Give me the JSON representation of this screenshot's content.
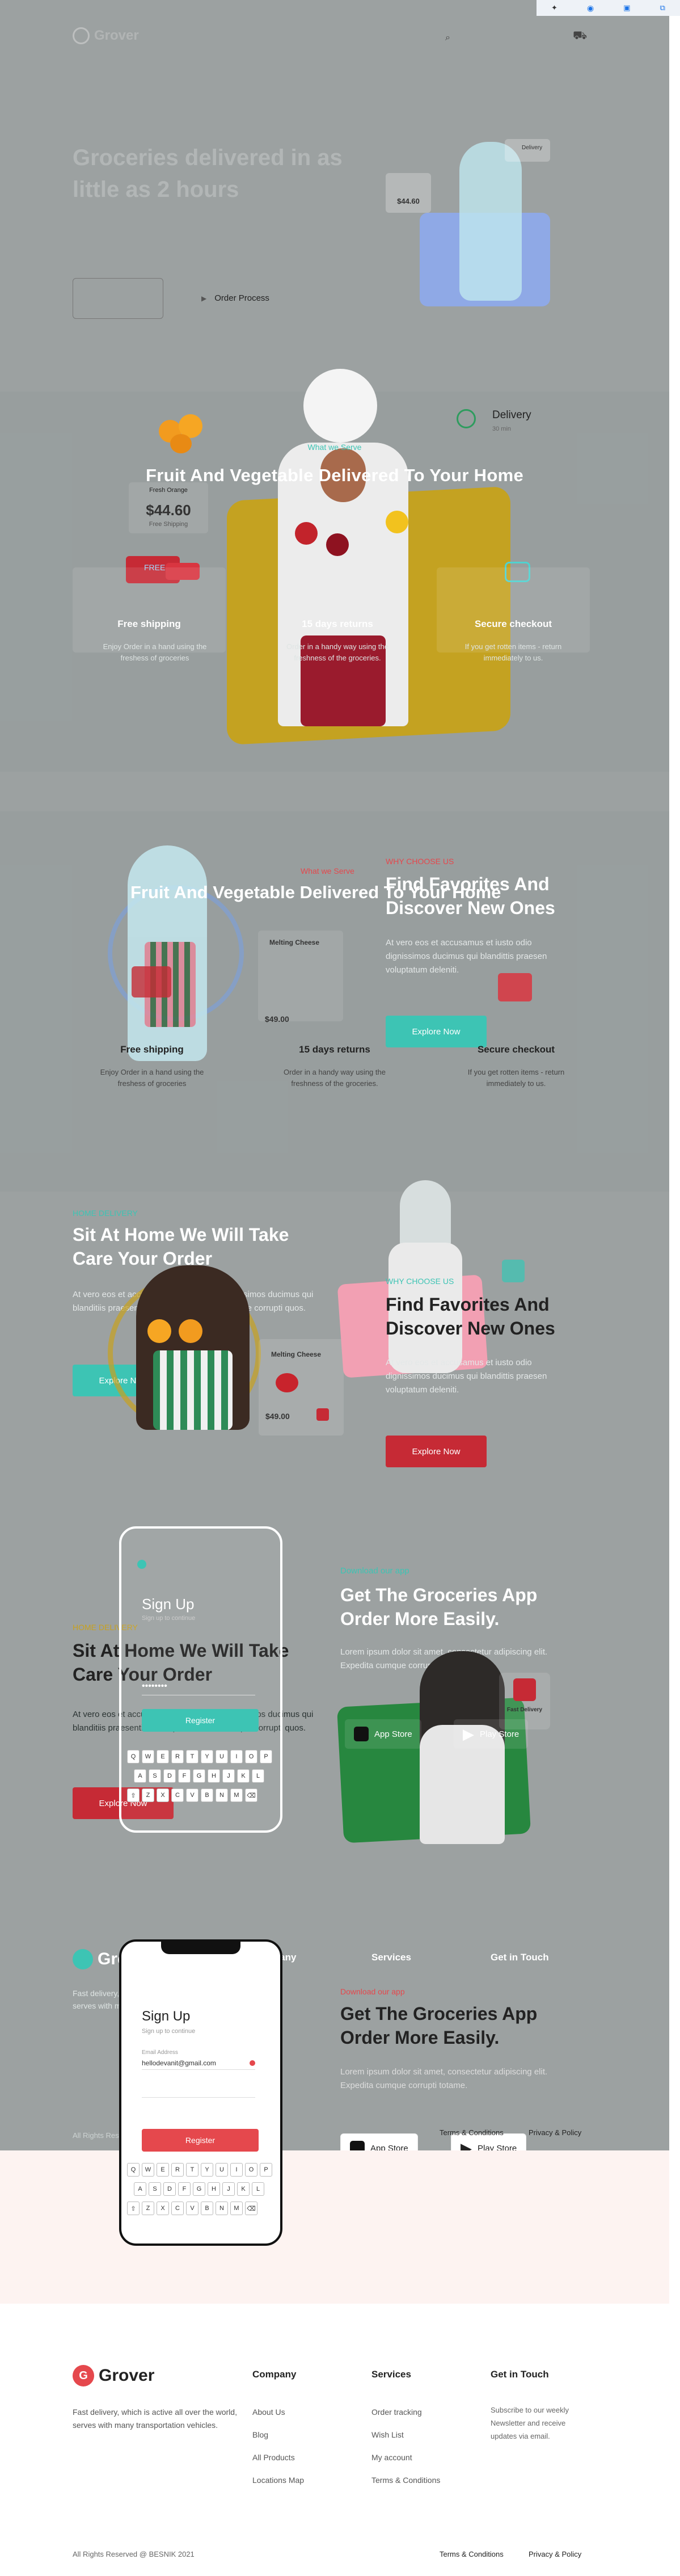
{
  "header": {
    "brand": "Grover"
  },
  "hero": {
    "title": "Groceries delivered in as little as 2 hours",
    "order_process": "Order Process",
    "price": "$44.60",
    "delivery": "Delivery"
  },
  "services": {
    "subtitle": "What we Serve",
    "heading": "Fruit And Vegetable Delivered To Your Home",
    "price_card": {
      "label": "Fresh Orange",
      "price": "$44.60",
      "note": "Free Shipping"
    },
    "free_badge": "FREE",
    "delivery_card": {
      "title": "Delivery",
      "time": "30 min"
    },
    "features": [
      {
        "title": "Free shipping",
        "desc": "Enjoy Order in a hand using the freshess of groceries"
      },
      {
        "title": "15 days returns",
        "desc": "Order in a handy way using the freshness of the groceries."
      },
      {
        "title": "Secure checkout",
        "desc": "If you get rotten items - return immediately to us."
      }
    ]
  },
  "why": {
    "ghost_subtitle": "What we Serve",
    "ghost_heading": "Fruit And Vegetable Delivered To Your Home",
    "label": "WHY CHOOSE US",
    "heading": "Find Favorites And Discover New Ones",
    "paragraph": "At vero eos et accusamus et iusto odio dignissimos ducimus qui blandittis praesen voluptatum deleniti.",
    "button": "Explore Now",
    "product_card": {
      "name": "Melting Cheese",
      "price": "$49.00"
    }
  },
  "home": {
    "label": "HOME DELIVERY",
    "heading": "Sit At Home We Will Take Care Your Order",
    "paragraph": "At vero eos et accusamus et iusto odio dignissimos ducimus qui blanditiis praesentium voluptatum deleniti atque corrupti quos.",
    "button": "Explore Now",
    "product_card": {
      "name": "Melting Cheese",
      "price": "$49.00"
    }
  },
  "download": {
    "label": "Download our app",
    "heading": "Get The Groceries App Order More Easily.",
    "paragraph": "Lorem ipsum dolor sit amet, consectetur adipiscing elit. Expedita cumque corrupti totame.",
    "app_store": "App Store",
    "play_store": "Play Store",
    "card_title": "Fast Delivery"
  },
  "signup": {
    "title": "Sign Up",
    "subtitle": "Sign up to continue",
    "email_label": "Email Address",
    "email": "hellodevanit@gmail.com",
    "password": "••••••••",
    "button": "Register"
  },
  "keyboard": {
    "rows": [
      [
        "Q",
        "W",
        "E",
        "R",
        "T",
        "Y",
        "U",
        "I",
        "O",
        "P"
      ],
      [
        "A",
        "S",
        "D",
        "F",
        "G",
        "H",
        "J",
        "K",
        "L"
      ],
      [
        "⇧",
        "Z",
        "X",
        "C",
        "V",
        "B",
        "N",
        "M",
        "⌫"
      ]
    ]
  },
  "footer": {
    "brand": "Grover",
    "about": "Fast delivery, which is active all over the world, serves with many transportation vehicles.",
    "columns": [
      {
        "title": "Company",
        "links": [
          "About Us",
          "Blog",
          "All Products",
          "Locations Map"
        ]
      },
      {
        "title": "Services",
        "links": [
          "Order tracking",
          "Wish List",
          "My account",
          "Terms & Conditions"
        ]
      },
      {
        "title": "Get in Touch",
        "text": "Subscribe to our weekly Newsletter and receive updates via email."
      }
    ],
    "copyright": "All Rights Reserved @ BESNIK 2021",
    "terms": "Terms & Conditions",
    "privacy": "Privacy & Policy"
  }
}
